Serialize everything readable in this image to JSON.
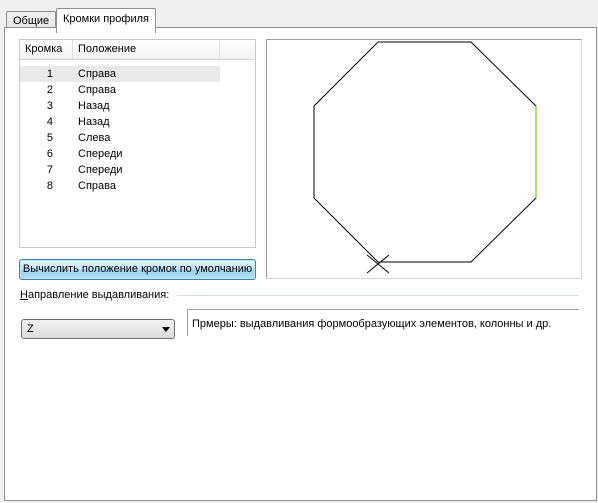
{
  "tabs": [
    {
      "label": "Общие",
      "active": false
    },
    {
      "label": "Кромки профиля",
      "active": true
    }
  ],
  "edges_table": {
    "columns": [
      "Кромка",
      "Положение"
    ],
    "rows": [
      {
        "index": "1",
        "position": "Справа"
      },
      {
        "index": "2",
        "position": "Справа"
      },
      {
        "index": "3",
        "position": "Назад"
      },
      {
        "index": "4",
        "position": "Назад"
      },
      {
        "index": "5",
        "position": "Слева"
      },
      {
        "index": "6",
        "position": "Спереди"
      },
      {
        "index": "7",
        "position": "Спереди"
      },
      {
        "index": "8",
        "position": "Справа"
      }
    ],
    "selected_row": 1
  },
  "compute_button": {
    "label": "Вычислить положение кромок по умолчанию"
  },
  "extrusion": {
    "label_accel": "Н",
    "label_rest": "аправление выдавливания:",
    "direction_value": "Z",
    "hint": "Прмеры: выдавливания формообразующих элементов,  колонны и др."
  },
  "colors": {
    "highlight_edge": "#8ddf2c",
    "outline": "#000000"
  }
}
